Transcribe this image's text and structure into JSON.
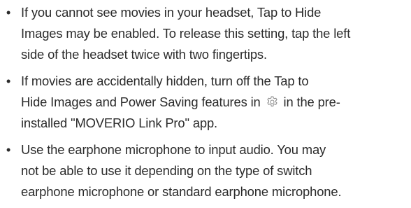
{
  "notes": [
    {
      "bullet": "•",
      "lines": [
        "If you cannot see movies in your headset, Tap to Hide",
        "Images may be enabled. To release this setting, tap the left",
        "side of the headset twice with two fingertips."
      ]
    },
    {
      "bullet": "•",
      "lines": [
        "If movies are accidentally hidden, turn off the Tap to",
        "Hide Images and Power Saving features in",
        "in the pre-",
        "installed \"MOVERIO Link Pro\" app."
      ],
      "icon": "gear-icon"
    },
    {
      "bullet": "•",
      "lines": [
        "Use the earphone microphone to input audio. You may",
        "not be able to use it depending on the type of switch",
        "earphone microphone or standard earphone microphone."
      ]
    }
  ]
}
